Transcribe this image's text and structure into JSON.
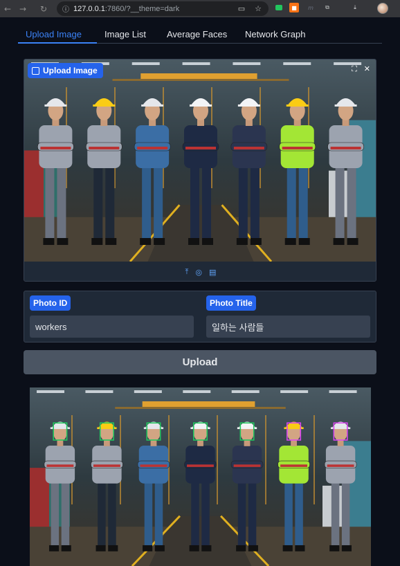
{
  "browser": {
    "url_host": "127.0.0.1",
    "url_rest": ":7860/?__theme=dark"
  },
  "tabs": [
    {
      "label": "Upload Image",
      "active": true
    },
    {
      "label": "Image List",
      "active": false
    },
    {
      "label": "Average Faces",
      "active": false
    },
    {
      "label": "Network Graph",
      "active": false
    }
  ],
  "upload": {
    "label": "Upload Image"
  },
  "form": {
    "photo_id_label": "Photo ID",
    "photo_id_value": "workers",
    "photo_title_label": "Photo Title",
    "photo_title_value": "일하는 사람들"
  },
  "upload_button": "Upload",
  "colors": {
    "accent": "#3b82f6",
    "label_bg": "#2563eb",
    "panel_bg": "#1f2937",
    "page_bg": "#0b0f19",
    "face_box_green": "#22c55e",
    "face_box_magenta": "#d946ef"
  },
  "workers": [
    {
      "helmet": "#e5e7eb",
      "shirt": "#9ca3af",
      "pants": "#6b7280",
      "face_box": "#22c55e"
    },
    {
      "helmet": "#facc15",
      "shirt": "#9ca3af",
      "pants": "#1f2937",
      "face_box": "#22c55e"
    },
    {
      "helmet": "#e5e7eb",
      "shirt": "#3b6ea5",
      "pants": "#2f5d8c",
      "face_box": "#22c55e"
    },
    {
      "helmet": "#f3f4f6",
      "shirt": "#1e2a44",
      "pants": "#1e2a44",
      "face_box": "#22c55e"
    },
    {
      "helmet": "#f3f4f6",
      "shirt": "#2b3550",
      "pants": "#1e2a44",
      "face_box": "#22c55e"
    },
    {
      "helmet": "#facc15",
      "shirt": "#a3e635",
      "pants": "#2f5d8c",
      "face_box": "#d946ef"
    },
    {
      "helmet": "#e5e7eb",
      "shirt": "#9ca3af",
      "pants": "#6b7280",
      "face_box": "#d946ef"
    }
  ]
}
